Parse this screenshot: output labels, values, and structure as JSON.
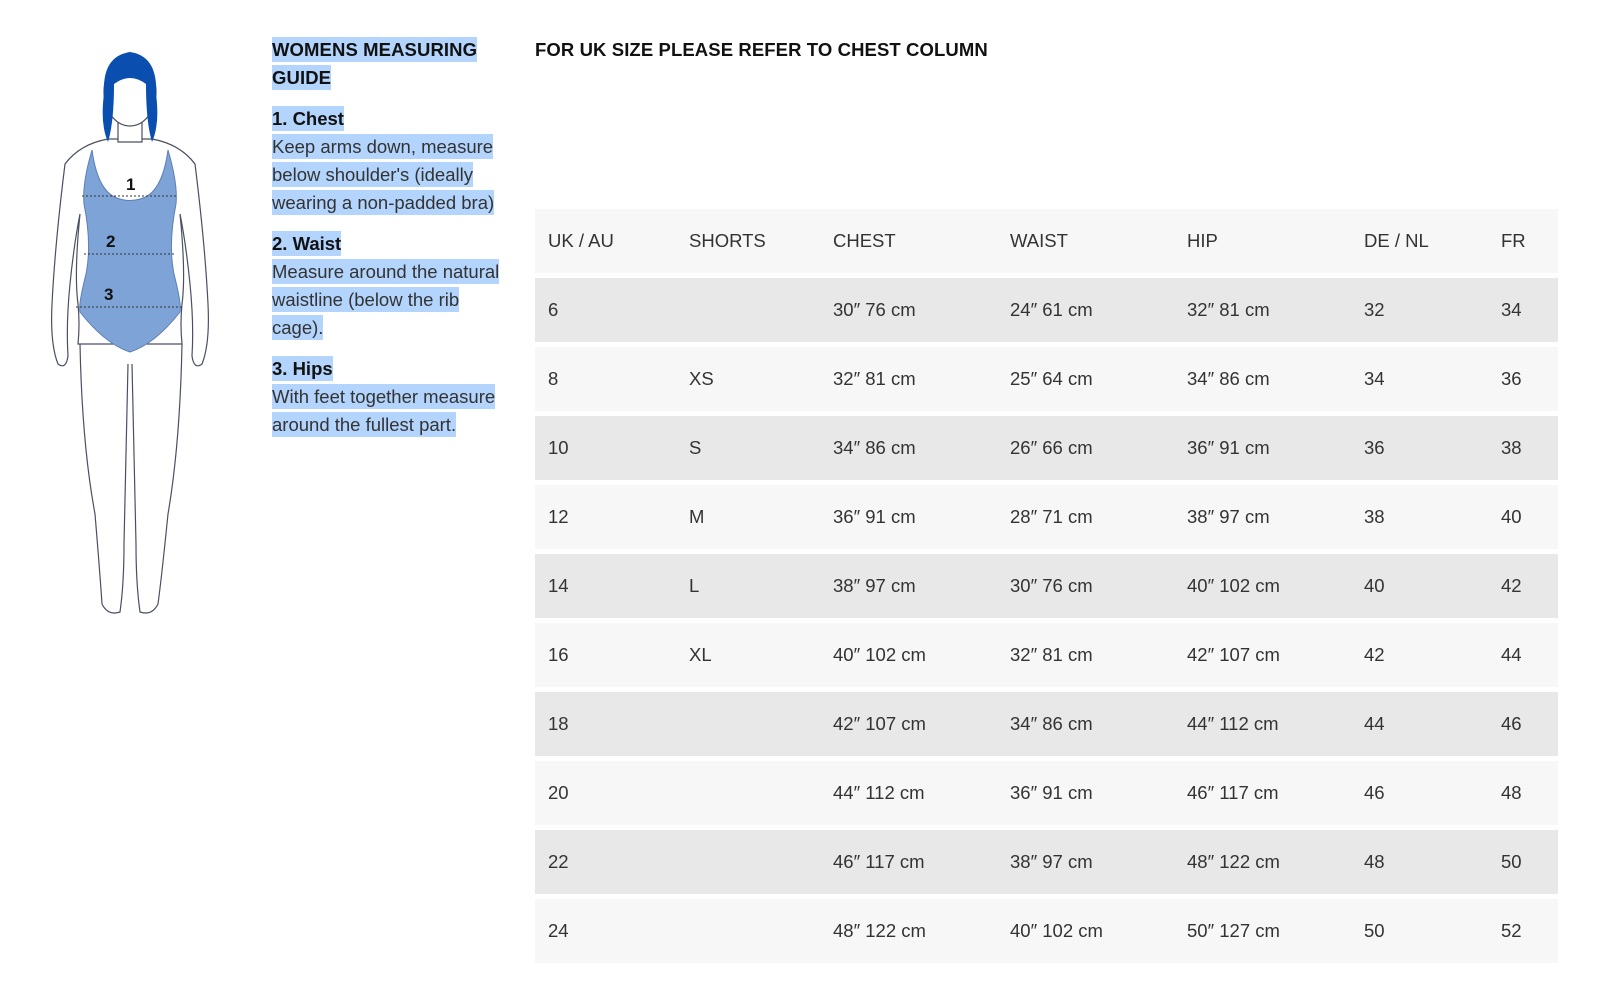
{
  "guide": {
    "title": "WOMENS MEASURING GUIDE",
    "steps": [
      {
        "heading": "1. Chest",
        "text": "Keep arms down, measure below shoulder's (ideally wearing a non-padded bra)"
      },
      {
        "heading": "2. Waist",
        "text": "Measure around the natural waistline (below the rib cage)."
      },
      {
        "heading": "3. Hips",
        "text": "With feet together measure around the fullest part."
      }
    ]
  },
  "figure": {
    "labels": [
      "1",
      "2",
      "3"
    ],
    "colors": {
      "hair": "#0a4fb0",
      "swimsuit": "#7ea3d6",
      "outline": "#4a4f63"
    }
  },
  "note": "FOR UK SIZE PLEASE REFER TO CHEST COLUMN",
  "table": {
    "headers": [
      "UK / AU",
      "SHORTS",
      "CHEST",
      "WAIST",
      "HIP",
      "DE / NL",
      "FR"
    ],
    "rows": [
      [
        "6",
        "",
        "30″ 76 cm",
        "24″ 61 cm",
        "32″ 81 cm",
        "32",
        "34"
      ],
      [
        "8",
        "XS",
        "32″ 81 cm",
        "25″ 64 cm",
        "34″ 86 cm",
        "34",
        "36"
      ],
      [
        "10",
        "S",
        "34″ 86 cm",
        "26″ 66 cm",
        "36″ 91 cm",
        "36",
        "38"
      ],
      [
        "12",
        "M",
        "36″ 91 cm",
        "28″ 71 cm",
        "38″ 97 cm",
        "38",
        "40"
      ],
      [
        "14",
        "L",
        "38″ 97 cm",
        "30″ 76 cm",
        "40″ 102 cm",
        "40",
        "42"
      ],
      [
        "16",
        "XL",
        "40″ 102 cm",
        "32″ 81 cm",
        "42″ 107 cm",
        "42",
        "44"
      ],
      [
        "18",
        "",
        "42″ 107 cm",
        "34″ 86 cm",
        "44″ 112 cm",
        "44",
        "46"
      ],
      [
        "20",
        "",
        "44″ 112 cm",
        "36″ 91 cm",
        "46″ 117 cm",
        "46",
        "48"
      ],
      [
        "22",
        "",
        "46″ 117 cm",
        "38″ 97 cm",
        "48″ 122 cm",
        "48",
        "50"
      ],
      [
        "24",
        "",
        "48″ 122 cm",
        "40″ 102 cm",
        "50″ 127 cm",
        "50",
        "52"
      ]
    ]
  }
}
